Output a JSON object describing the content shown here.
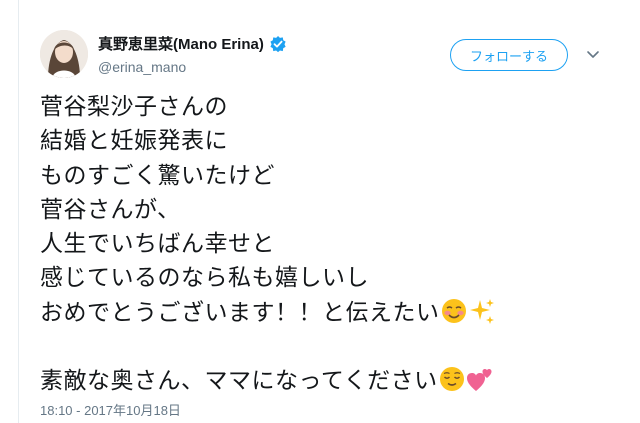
{
  "profile": {
    "display_name": "真野恵里菜(Mano Erina)",
    "handle": "@erina_mano",
    "verified_icon": "verified-badge-icon"
  },
  "actions": {
    "follow_label": "フォローする",
    "menu_icon": "chevron-down-icon"
  },
  "tweet": {
    "lines": [
      "菅谷梨沙子さんの",
      "結婚と妊娠発表に",
      "ものすごく驚いたけど",
      "菅谷さんが、",
      "人生でいちばん幸せと",
      "感じているのなら私も嬉しいし",
      "おめでとうございます！！と伝えたい",
      "",
      "素敵な奥さん、ママになってください"
    ],
    "line7_emojis": [
      "smiling-blush-emoji",
      "sparkles-emoji"
    ],
    "line9_emojis": [
      "relieved-face-emoji",
      "two-hearts-emoji"
    ]
  },
  "meta": {
    "timestamp": "18:10 - 2017年10月18日"
  },
  "colors": {
    "accent": "#1da1f2",
    "text": "#14171a",
    "secondary": "#657786"
  }
}
